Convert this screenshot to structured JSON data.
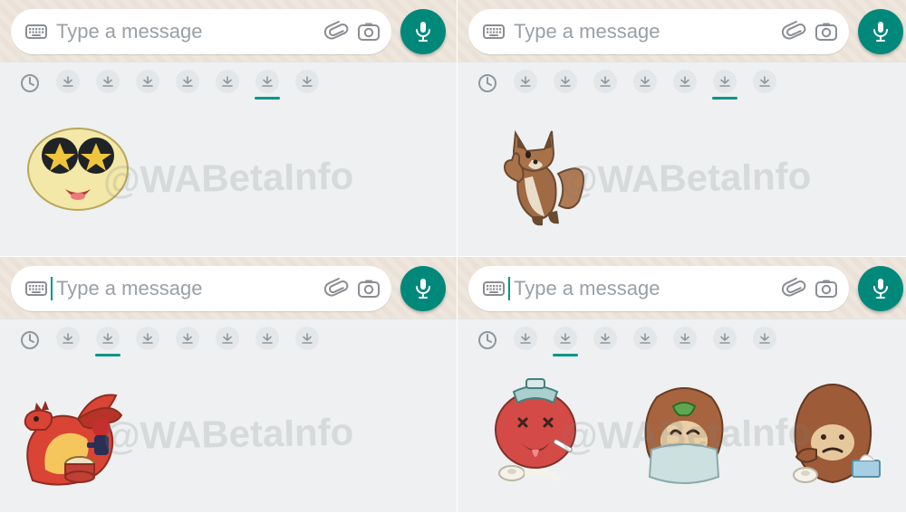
{
  "watermark": "@WABetaInfo",
  "panes": [
    {
      "input": {
        "placeholder": "Type a message",
        "value": "",
        "cursorActive": false
      },
      "packs": {
        "count": 7,
        "selectedIndex": 5
      },
      "stickers": [
        "star-eyes-face"
      ]
    },
    {
      "input": {
        "placeholder": "Type a message",
        "value": "",
        "cursorActive": false
      },
      "packs": {
        "count": 7,
        "selectedIndex": 5
      },
      "stickers": [
        "fox-thumbs-up"
      ]
    },
    {
      "input": {
        "placeholder": "Type a message",
        "value": "",
        "cursorActive": true
      },
      "packs": {
        "count": 7,
        "selectedIndex": 1
      },
      "stickers": [
        "red-dragon-band"
      ]
    },
    {
      "input": {
        "placeholder": "Type a message",
        "value": "",
        "cursorActive": true
      },
      "packs": {
        "count": 7,
        "selectedIndex": 1
      },
      "stickers": [
        "sick-creature-1",
        "sick-creature-2",
        "sick-creature-3"
      ]
    }
  ],
  "icons": {
    "keyboard": "keyboard-icon",
    "attach": "paperclip-icon",
    "camera": "camera-icon",
    "mic": "mic-icon",
    "recent": "clock-icon",
    "download": "download-icon"
  }
}
